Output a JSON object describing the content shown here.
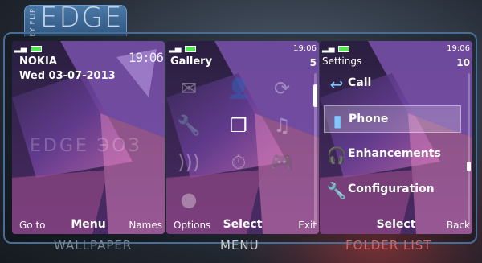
{
  "brand": {
    "by_label": "BY FLIP",
    "logo_text": "EDGE"
  },
  "screens": {
    "wallpaper": {
      "operator": "NOKIA",
      "date": "Wed 03-07-2013",
      "clock": "19:06",
      "watermark": "EDGE ЭОЗ",
      "softkeys": {
        "left": "Go to",
        "center": "Menu",
        "right": "Names"
      }
    },
    "menu": {
      "time": "19:06",
      "title": "Gallery",
      "count": "5",
      "icons": [
        "mail-icon",
        "contacts-icon",
        "sync-icon",
        "settings-icon",
        "gallery-icon",
        "music-icon",
        "wifi-icon",
        "timer-icon",
        "games-icon",
        "globe-icon"
      ],
      "softkeys": {
        "left": "Options",
        "center": "Select",
        "right": "Exit"
      }
    },
    "folder_list": {
      "time": "19:06",
      "title": "Settings",
      "count": "10",
      "items": [
        {
          "label": "Call",
          "icon": "call-icon"
        },
        {
          "label": "Phone",
          "icon": "phone-icon"
        },
        {
          "label": "Enhancements",
          "icon": "headset-icon"
        },
        {
          "label": "Configuration",
          "icon": "wrench-icon"
        }
      ],
      "selected_index": 1,
      "softkeys": {
        "left": "",
        "center": "Select",
        "right": "Back"
      }
    }
  },
  "captions": {
    "wallpaper": "WALLPAPER",
    "menu": "MENU",
    "folder_list": "FOLDER LIST"
  },
  "colors": {
    "frame": "#4a6d96",
    "battery": "#5be15b",
    "caption_active": "#d66464"
  }
}
